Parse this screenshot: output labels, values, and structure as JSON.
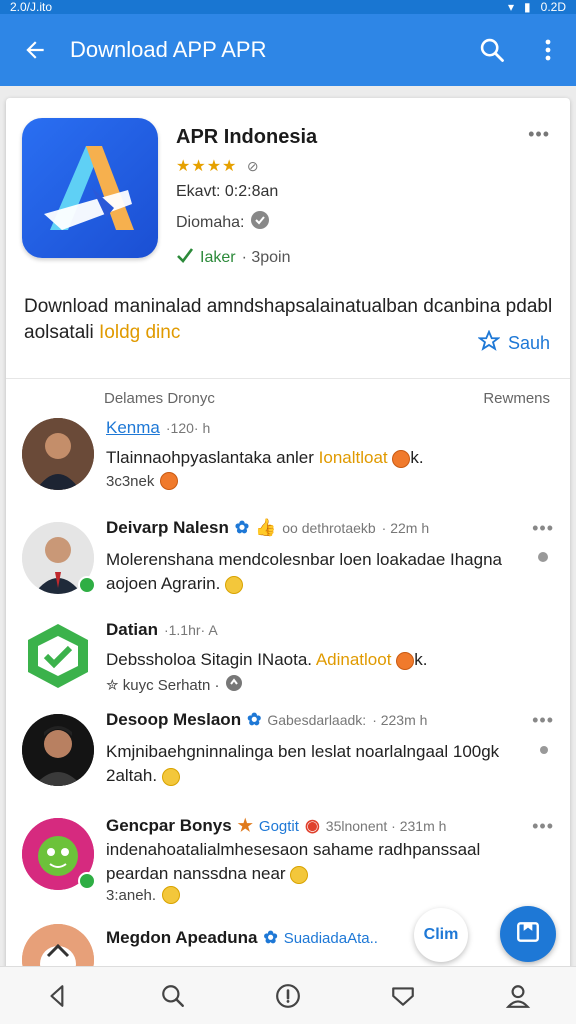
{
  "status_bar": {
    "time": "2.0/J.ito",
    "battery": "0.2D"
  },
  "app_bar": {
    "title": "Download APP APR"
  },
  "app": {
    "name": "APR Indonesia",
    "stars": "★★★★",
    "rating_count": "0",
    "meta1": "Ekavt: 0:2:8an",
    "meta2": "Diomaha:",
    "meta3_status": "Iaker",
    "meta3_extra": "· 3poin",
    "description": "Download maninalad amndshapsalainatualban dcanbina pdabl aolsatali",
    "description_highlight": "Ioldg dinc",
    "save_label": "Sauh"
  },
  "comments_header": {
    "left": "Delames Dronyc",
    "right": "Rewmens"
  },
  "comments": [
    {
      "name": "Kenma",
      "time": "·120· h",
      "text": "Tlainnaohpyaslantaka anler",
      "text_highlight": "Ionaltloat",
      "text_tail": "k.",
      "sub": "3c3nek"
    },
    {
      "name": "Deivarp Nalesn",
      "tag": "oo dethrotaekb",
      "time": "· 22m h",
      "text": "Molerenshana mendcolesnbar loen loakadae Ihagna aojoen Agrarin.",
      "sub": ""
    },
    {
      "name": "Datian",
      "time": "·1.1hr· A",
      "text": "Debssholoa Sitagin INaota.",
      "text_highlight": "Adinatloot",
      "text_tail": "k.",
      "sub": "✮ kuyc Serhatn ·"
    },
    {
      "name": "Desoop Meslaon",
      "tag": "Gabesdarlaadk:",
      "time": "· 223m h",
      "text": "Kmjnibaehgninnalinga ben leslat noarlalngaal 100gk 2altah.",
      "sub": ""
    },
    {
      "name": "Gencpar Bonys",
      "tag": "Gogtit",
      "time": "35lnonent · 231m h",
      "text": "indenahoatalialmhesesaon sahame radhpanssaal peardan nanssdna near",
      "sub": "3:aneh."
    },
    {
      "name": "Megdon Apeaduna",
      "tag": "SuadiadaAta..",
      "time": "",
      "text": "",
      "sub": ""
    }
  ],
  "fab_chat_label": "Clim",
  "icons": {
    "back": "back-arrow-icon",
    "search": "search-icon",
    "more": "more-vert-icon",
    "save": "star-outline-icon",
    "fab": "compose-icon",
    "nav": [
      "back-nav-icon",
      "search-nav-icon",
      "info-nav-icon",
      "shield-nav-icon",
      "profile-nav-icon"
    ]
  },
  "colors": {
    "primary": "#2e86e6",
    "accent": "#1e78d6",
    "highlight": "#e09a00",
    "verified": "#2c8a3a"
  }
}
